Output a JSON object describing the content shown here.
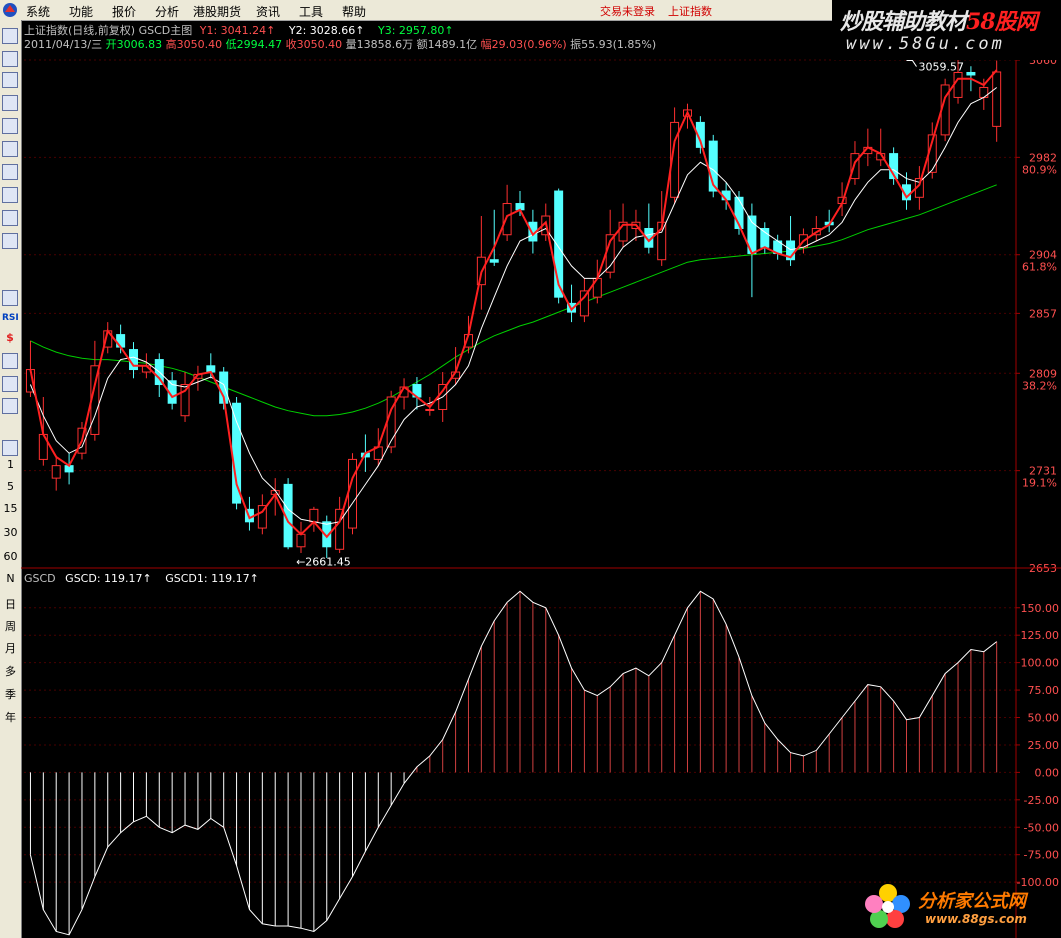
{
  "menu": {
    "items": [
      "系统",
      "功能",
      "报价",
      "分析",
      "港股期货",
      "资讯",
      "工具",
      "帮助"
    ],
    "status_login": "交易未登录",
    "status_index": "上证指数"
  },
  "brand": {
    "line1_a": "炒股辅助教材",
    "line1_b": "58股网",
    "line2": "www.58Gu.com"
  },
  "toolbar": {
    "icons": [
      "grid-icon",
      "table-icon",
      "line-chart-icon",
      "kline-icon",
      "news-icon",
      "f10-icon",
      "report-icon",
      "f-icon",
      "fx-icon",
      "zoom-icon",
      "wave-icon",
      "rsi-icon",
      "dollar-icon",
      "move-icon",
      "switch-icon",
      "pencil-icon",
      "fs-icon"
    ],
    "rsi_label": "RSI",
    "periods": [
      "1",
      "5",
      "15",
      "30",
      "60",
      "N",
      "日",
      "周",
      "月",
      "多",
      "季",
      "年"
    ]
  },
  "header": {
    "line1": {
      "title": "上证指数(日线,前复权) GSCD主图",
      "y1": "Y1: 3041.24↑",
      "y2": "Y2: 3028.66↑",
      "y3": "Y3: 2957.80↑"
    },
    "line2": {
      "date": "2011/04/13/三",
      "open": "开3006.83",
      "high": "高3050.40",
      "low": "低2994.47",
      "close": "收3050.40",
      "volume": "量13858.6万",
      "amount": "额1489.1亿",
      "change": "幅29.03(0.96%)",
      "amplitude": "振55.93(1.85%)"
    }
  },
  "colors": {
    "up": "#ff3030",
    "down": "#54ffff",
    "ma_fast": "#ff2020",
    "ma_mid": "#ffffff",
    "ma_slow": "#00d000",
    "grid": "#4a0000",
    "axis": "#a00000",
    "text_red": "#ff5050",
    "text_green": "#00ff40",
    "text_gray": "#c0c0c0"
  },
  "chart_data": [
    {
      "type": "candlestick",
      "title": "上证指数(日线,前复权) GSCD主图",
      "y_ticks": [
        3060,
        2982,
        2904,
        2857,
        2809,
        2731,
        2653
      ],
      "ylim": [
        2653,
        3060
      ],
      "fib_labels": [
        {
          "value": 2982,
          "label": "80.9%"
        },
        {
          "value": 2904,
          "label": "61.8%"
        },
        {
          "value": 2809,
          "label": "38.2%"
        },
        {
          "value": 2731,
          "label": "19.1%"
        }
      ],
      "annotations": [
        {
          "text": "3059.57",
          "index": 68,
          "value": 3059.57
        },
        {
          "text": "←2661.45",
          "index": 20,
          "value": 2661.45
        }
      ],
      "ohlc": [
        [
          2794,
          2812,
          2790,
          2835
        ],
        [
          2740,
          2760,
          2735,
          2790
        ],
        [
          2725,
          2735,
          2715,
          2742
        ],
        [
          2735,
          2730,
          2720,
          2745
        ],
        [
          2745,
          2765,
          2740,
          2770
        ],
        [
          2760,
          2815,
          2755,
          2835
        ],
        [
          2830,
          2843,
          2825,
          2850
        ],
        [
          2840,
          2830,
          2825,
          2848
        ],
        [
          2828,
          2812,
          2805,
          2834
        ],
        [
          2810,
          2815,
          2805,
          2825
        ],
        [
          2820,
          2800,
          2790,
          2825
        ],
        [
          2803,
          2785,
          2780,
          2810
        ],
        [
          2775,
          2800,
          2770,
          2810
        ],
        [
          2805,
          2808,
          2795,
          2815
        ],
        [
          2815,
          2810,
          2805,
          2825
        ],
        [
          2810,
          2785,
          2780,
          2814
        ],
        [
          2785,
          2705,
          2700,
          2790
        ],
        [
          2700,
          2690,
          2683,
          2710
        ],
        [
          2685,
          2703,
          2680,
          2712
        ],
        [
          2712,
          2715,
          2695,
          2725
        ],
        [
          2720,
          2670,
          2668,
          2725
        ],
        [
          2670,
          2680,
          2665,
          2690
        ],
        [
          2690,
          2700,
          2682,
          2702
        ],
        [
          2690,
          2670,
          2661,
          2695
        ],
        [
          2668,
          2700,
          2665,
          2710
        ],
        [
          2685,
          2740,
          2680,
          2745
        ],
        [
          2745,
          2742,
          2730,
          2760
        ],
        [
          2740,
          2750,
          2735,
          2765
        ],
        [
          2750,
          2790,
          2745,
          2795
        ],
        [
          2790,
          2798,
          2780,
          2805
        ],
        [
          2800,
          2790,
          2780,
          2806
        ],
        [
          2780,
          2780,
          2775,
          2790
        ],
        [
          2780,
          2800,
          2770,
          2810
        ],
        [
          2805,
          2810,
          2800,
          2830
        ],
        [
          2830,
          2840,
          2825,
          2855
        ],
        [
          2880,
          2902,
          2860,
          2935
        ],
        [
          2900,
          2898,
          2895,
          2940
        ],
        [
          2920,
          2945,
          2915,
          2960
        ],
        [
          2945,
          2940,
          2935,
          2955
        ],
        [
          2930,
          2915,
          2905,
          2940
        ],
        [
          2920,
          2935,
          2915,
          2945
        ],
        [
          2955,
          2870,
          2865,
          2957
        ],
        [
          2865,
          2858,
          2850,
          2880
        ],
        [
          2855,
          2875,
          2850,
          2885
        ],
        [
          2870,
          2885,
          2865,
          2900
        ],
        [
          2890,
          2920,
          2885,
          2940
        ],
        [
          2915,
          2930,
          2910,
          2945
        ],
        [
          2925,
          2930,
          2915,
          2940
        ],
        [
          2925,
          2910,
          2905,
          2945
        ],
        [
          2900,
          2930,
          2895,
          2955
        ],
        [
          2950,
          3010,
          2945,
          3022
        ],
        [
          3015,
          3020,
          3005,
          3025
        ],
        [
          3010,
          2990,
          2985,
          3015
        ],
        [
          2995,
          2955,
          2950,
          3000
        ],
        [
          2955,
          2948,
          2940,
          2962
        ],
        [
          2950,
          2925,
          2920,
          2955
        ],
        [
          2935,
          2905,
          2870,
          2945
        ],
        [
          2925,
          2910,
          2905,
          2930
        ],
        [
          2915,
          2905,
          2900,
          2920
        ],
        [
          2915,
          2900,
          2895,
          2935
        ],
        [
          2910,
          2920,
          2905,
          2925
        ],
        [
          2920,
          2925,
          2915,
          2935
        ],
        [
          2930,
          2928,
          2922,
          2940
        ],
        [
          2945,
          2950,
          2935,
          2962
        ],
        [
          2965,
          2985,
          2960,
          2995
        ],
        [
          2985,
          2990,
          2975,
          3005
        ],
        [
          2980,
          2985,
          2975,
          3005
        ],
        [
          2985,
          2965,
          2960,
          2990
        ],
        [
          2960,
          2948,
          2940,
          2970
        ],
        [
          2950,
          2965,
          2940,
          2975
        ],
        [
          2970,
          3000,
          2965,
          3010
        ],
        [
          3000,
          3040,
          2995,
          3045
        ],
        [
          3030,
          3050,
          3025,
          3060
        ],
        [
          3050,
          3048,
          3035,
          3055
        ],
        [
          3030,
          3038,
          3020,
          3045
        ],
        [
          3006.83,
          3050.4,
          2994.47,
          3059.57
        ]
      ],
      "ma_fast": [
        2812,
        2760,
        2742,
        2735,
        2755,
        2800,
        2843,
        2830,
        2815,
        2815,
        2805,
        2790,
        2795,
        2808,
        2810,
        2790,
        2720,
        2693,
        2698,
        2712,
        2690,
        2680,
        2690,
        2678,
        2690,
        2725,
        2745,
        2750,
        2780,
        2798,
        2790,
        2782,
        2795,
        2810,
        2840,
        2890,
        2910,
        2935,
        2940,
        2920,
        2930,
        2880,
        2860,
        2870,
        2885,
        2915,
        2928,
        2928,
        2915,
        2925,
        2995,
        3018,
        2995,
        2960,
        2948,
        2928,
        2905,
        2910,
        2905,
        2902,
        2915,
        2922,
        2928,
        2945,
        2978,
        2990,
        2985,
        2968,
        2950,
        2960,
        2995,
        3030,
        3045,
        3045,
        3040,
        3052
      ],
      "ma_mid": [
        2800,
        2775,
        2755,
        2745,
        2750,
        2775,
        2805,
        2820,
        2822,
        2818,
        2810,
        2800,
        2798,
        2802,
        2806,
        2800,
        2770,
        2745,
        2725,
        2715,
        2700,
        2692,
        2690,
        2688,
        2690,
        2705,
        2720,
        2735,
        2755,
        2772,
        2782,
        2785,
        2790,
        2800,
        2815,
        2845,
        2870,
        2895,
        2915,
        2920,
        2925,
        2910,
        2895,
        2885,
        2885,
        2895,
        2910,
        2918,
        2920,
        2922,
        2945,
        2968,
        2978,
        2972,
        2962,
        2948,
        2930,
        2922,
        2915,
        2908,
        2910,
        2915,
        2920,
        2930,
        2948,
        2962,
        2972,
        2972,
        2965,
        2962,
        2972,
        2990,
        3010,
        3025,
        3030,
        3038
      ],
      "ma_slow": [
        2835,
        2830,
        2826,
        2823,
        2821,
        2820,
        2820,
        2819,
        2818,
        2817,
        2815,
        2813,
        2810,
        2806,
        2802,
        2798,
        2794,
        2790,
        2786,
        2782,
        2779,
        2777,
        2775,
        2775,
        2776,
        2778,
        2781,
        2785,
        2790,
        2796,
        2802,
        2808,
        2815,
        2822,
        2828,
        2834,
        2839,
        2843,
        2847,
        2850,
        2854,
        2858,
        2862,
        2866,
        2870,
        2874,
        2878,
        2882,
        2886,
        2890,
        2894,
        2898,
        2900,
        2901,
        2902,
        2903,
        2904,
        2905,
        2906,
        2907,
        2909,
        2911,
        2913,
        2916,
        2920,
        2924,
        2927,
        2930,
        2933,
        2936,
        2940,
        2944,
        2948,
        2952,
        2956,
        2960
      ]
    },
    {
      "type": "bar",
      "title": "GSCD",
      "legend": [
        {
          "label": "GSCD: 119.17↑"
        },
        {
          "label": "GSCD1: 119.17↑"
        }
      ],
      "y_ticks": [
        150,
        125,
        100,
        75,
        50,
        25,
        0,
        -25,
        -50,
        -75,
        -100
      ],
      "ylim": [
        -150,
        168
      ],
      "values": [
        -75,
        -125,
        -145,
        -148,
        -125,
        -95,
        -68,
        -55,
        -45,
        -40,
        -50,
        -55,
        -48,
        -52,
        -42,
        -50,
        -85,
        -125,
        -138,
        -140,
        -140,
        -142,
        -145,
        -135,
        -115,
        -95,
        -72,
        -50,
        -30,
        -10,
        5,
        15,
        30,
        55,
        85,
        115,
        138,
        155,
        165,
        155,
        150,
        125,
        95,
        75,
        70,
        78,
        90,
        95,
        88,
        100,
        125,
        150,
        165,
        158,
        135,
        105,
        70,
        45,
        30,
        18,
        15,
        20,
        35,
        50,
        65,
        80,
        78,
        65,
        48,
        50,
        70,
        90,
        100,
        112,
        110,
        119.17
      ]
    }
  ]
}
